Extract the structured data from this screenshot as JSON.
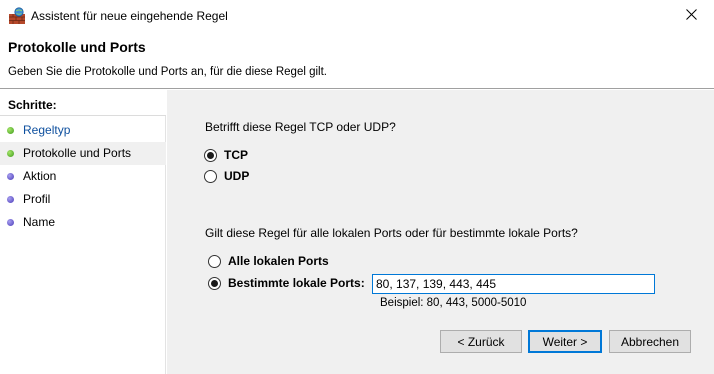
{
  "window": {
    "title": "Assistent für neue eingehende Regel"
  },
  "header": {
    "title": "Protokolle und Ports",
    "subtitle": "Geben Sie die Protokolle und Ports an, für die diese Regel gilt."
  },
  "sidebar": {
    "heading": "Schritte:",
    "steps": [
      {
        "label": "Regeltyp",
        "state": "done"
      },
      {
        "label": "Protokolle und Ports",
        "state": "current"
      },
      {
        "label": "Aktion",
        "state": "pending"
      },
      {
        "label": "Profil",
        "state": "pending"
      },
      {
        "label": "Name",
        "state": "pending"
      }
    ]
  },
  "protocol": {
    "question": "Betrifft diese Regel TCP oder UDP?",
    "options": [
      {
        "label": "TCP",
        "checked": true
      },
      {
        "label": "UDP",
        "checked": false
      }
    ]
  },
  "ports": {
    "question": "Gilt diese Regel für alle lokalen Ports oder für bestimmte lokale Ports?",
    "options": [
      {
        "label": "Alle lokalen Ports",
        "checked": false
      },
      {
        "label": "Bestimmte lokale Ports:",
        "checked": true
      }
    ],
    "value": "80, 137, 139, 443, 445",
    "example": "Beispiel: 80, 443, 5000-5010"
  },
  "buttons": {
    "back": "< Zurück",
    "next": "Weiter >",
    "cancel": "Abbrechen"
  },
  "colors": {
    "accent": "#0078d7",
    "link": "#0d4f9e",
    "content_bg": "#f0f0f0"
  }
}
